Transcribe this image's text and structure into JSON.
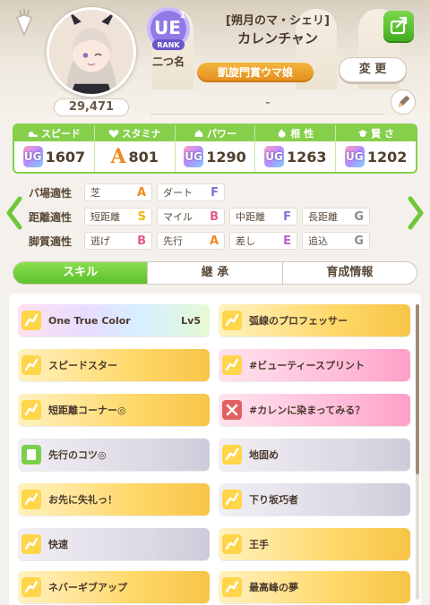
{
  "header": {
    "fan_count": "29,471",
    "rank_label": "RANK",
    "nickname": "二つ名",
    "title_small": "[朔月のマ・シェリ]",
    "name": "カレンチャン",
    "title_plate": "凱旋門賞ウマ娘",
    "change_label": "変 更",
    "comment": "-"
  },
  "stats": [
    {
      "label": "スピード",
      "grade": "UG",
      "value": "1607"
    },
    {
      "label": "スタミナ",
      "grade": "A",
      "value": "801"
    },
    {
      "label": "パワー",
      "grade": "UG",
      "value": "1290"
    },
    {
      "label": "根 性",
      "grade": "UG",
      "value": "1263"
    },
    {
      "label": "賢 さ",
      "grade": "UG",
      "value": "1202"
    }
  ],
  "aptitude": {
    "ground": {
      "label": "バ場適性",
      "items": [
        {
          "name": "芝",
          "grade": "A"
        },
        {
          "name": "ダート",
          "grade": "F"
        }
      ]
    },
    "distance": {
      "label": "距離適性",
      "items": [
        {
          "name": "短距離",
          "grade": "S"
        },
        {
          "name": "マイル",
          "grade": "B"
        },
        {
          "name": "中距離",
          "grade": "F"
        },
        {
          "name": "長距離",
          "grade": "G"
        }
      ]
    },
    "style": {
      "label": "脚質適性",
      "items": [
        {
          "name": "逃げ",
          "grade": "B"
        },
        {
          "name": "先行",
          "grade": "A"
        },
        {
          "name": "差し",
          "grade": "E"
        },
        {
          "name": "追込",
          "grade": "G"
        }
      ]
    }
  },
  "tabs": [
    "スキル",
    "継 承",
    "育成情報"
  ],
  "skills": [
    {
      "name": "One True Color",
      "level": "Lv5"
    },
    {
      "name": "弧線のプロフェッサー"
    },
    {
      "name": "スピードスター"
    },
    {
      "name": "#ビューティースプリント"
    },
    {
      "name": "短距離コーナー◎"
    },
    {
      "name": "#カレンに染まってみる？"
    },
    {
      "name": "先行のコツ◎"
    },
    {
      "name": "地固め"
    },
    {
      "name": "お先に失礼っ！"
    },
    {
      "name": "下り坂巧者"
    },
    {
      "name": "快速"
    },
    {
      "name": "王手"
    },
    {
      "name": "ネバーギブアップ"
    },
    {
      "name": "最高峰の夢"
    }
  ]
}
